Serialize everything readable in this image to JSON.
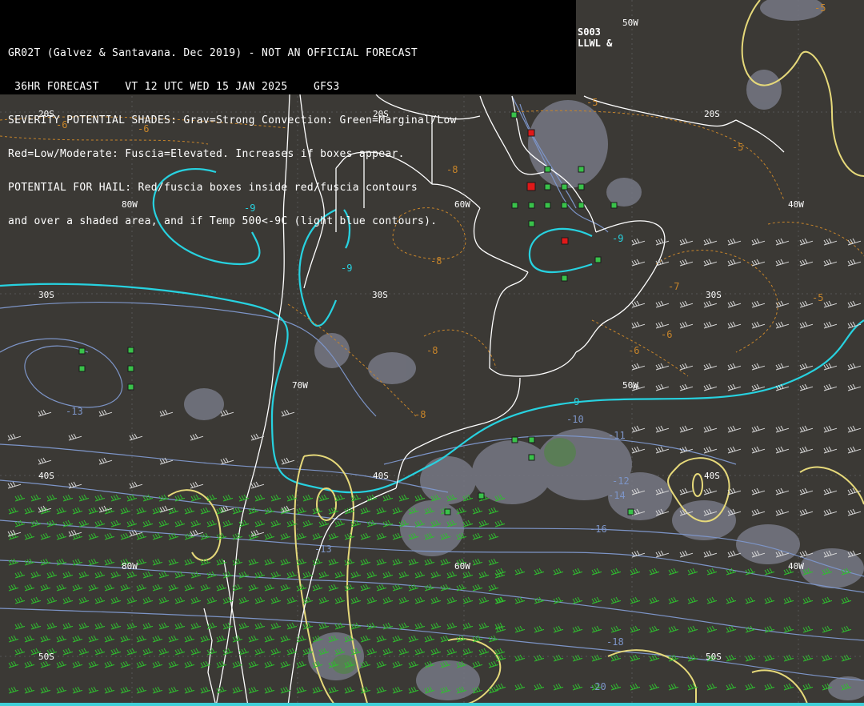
{
  "header": {
    "lines": [
      "GR02T (Galvez & Santavana. Dec 2019) - NOT AN OFFICIAL FORECAST",
      " 36HR FORECAST    VT 12 UTC WED 15 JAN 2025    GFS3",
      "SEVERITY POTENTIAL SHADES: Grav=Strong Convection: Green=Marginal/Low",
      "Red=Low/Moderate: Fuscia=Elevated. Increases if boxes appear.",
      "POTENTIAL FOR HAIL: Red/fuscia boxes inside red/fuscia contours",
      "and over a shaded area, and if Temp 500<-9C (light blue contours)."
    ],
    "code_top": "S003",
    "code_bottom": "LLWL &"
  },
  "grid_labels": [
    "50W",
    "20S",
    "20S",
    "20S",
    "80W",
    "60W",
    "40W",
    "30S",
    "30S",
    "30S",
    "70W",
    "50W",
    "40S",
    "40S",
    "40S",
    "80W",
    "60W",
    "40W",
    "50S",
    "50S"
  ],
  "temp_labels": [
    "-5",
    "-6",
    "-5",
    "-6",
    "-5",
    "-8",
    "-9",
    "-9",
    "-8",
    "-9",
    "-7",
    "-5",
    "-6",
    "-8",
    "-6",
    "-8",
    "-9",
    "-10",
    "-11",
    "-12",
    "-13",
    "-13",
    "-14",
    "-16",
    "-18",
    "-20"
  ],
  "colors": {
    "background": "#3b3935",
    "temp_500_minus9_contour": "#27d2e0",
    "thickness_contour": "#7d95c8",
    "dashed_contour": "#c8852a",
    "yellow_contour": "#e6d97a",
    "coastline": "#ffffff",
    "shade_strong": "#767884",
    "marginal_green": "#39c24a",
    "low_moderate_red": "#e01919",
    "wind_barb": "#2fbf2f"
  }
}
